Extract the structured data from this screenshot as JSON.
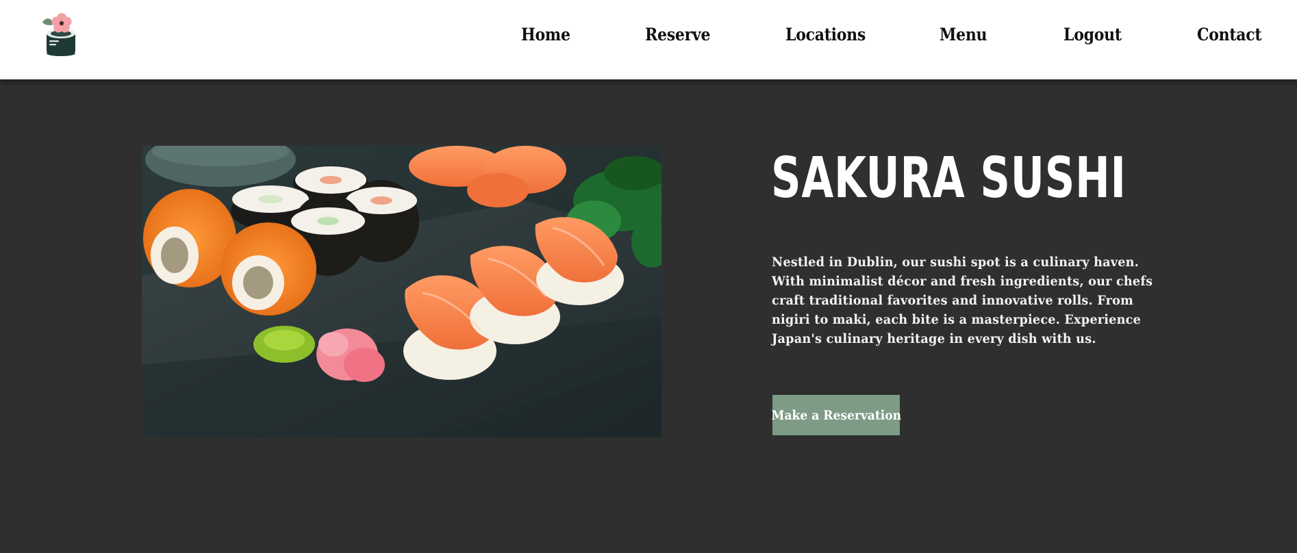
{
  "header": {
    "logo_icon": "sushi-roll-with-sakura-flower-icon",
    "nav": {
      "home": "Home",
      "reserve": "Reserve",
      "locations": "Locations",
      "menu": "Menu",
      "logout": "Logout",
      "contact": "Contact"
    }
  },
  "hero": {
    "image": "sushi platter on slate board with salmon nigiri, maki rolls, wasabi, pickled ginger and seaweed salad",
    "title": "SAKURA SUSHI",
    "description_lines": [
      "Nestled in Dublin, our sushi spot is a culinary haven.",
      "With minimalist décor and fresh ingredients, our chefs",
      "craft traditional favorites and innovative rolls. From",
      "nigiri to maki, each bite is a masterpiece. Experience",
      "Japan's culinary heritage in every dish with us."
    ],
    "cta_label": "Make a Reservation"
  },
  "colors": {
    "background": "#2f2f2f",
    "header": "#ffffff",
    "accent_button": "#7e9b85",
    "text": "#ffffff"
  }
}
